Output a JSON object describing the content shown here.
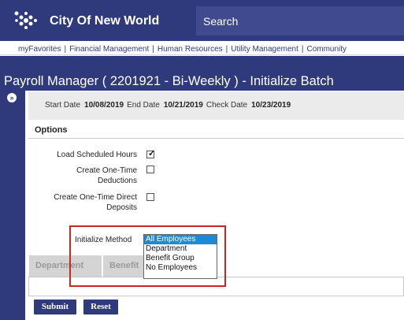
{
  "header": {
    "app_title": "City Of New World",
    "search_label": "Search"
  },
  "nav": {
    "items": [
      "myFavorites",
      "Financial Management",
      "Human Resources",
      "Utility Management",
      "Community"
    ],
    "separator": "|"
  },
  "page": {
    "title": "Payroll Manager ( 2201921 - Bi-Weekly ) - Initialize Batch",
    "expand_glyph": "»"
  },
  "dates": {
    "start_label": "Start Date",
    "start_value": "10/08/2019",
    "end_label": "End Date",
    "end_value": "10/21/2019",
    "check_label": "Check Date",
    "check_value": "10/23/2019"
  },
  "options": {
    "heading": "Options",
    "load_scheduled_hours": {
      "label": "Load Scheduled Hours",
      "checked": true
    },
    "one_time_deductions": {
      "label_line1": "Create One-Time",
      "label_line2": "Deductions",
      "checked": false
    },
    "one_time_deposits": {
      "label_line1": "Create One-Time Direct",
      "label_line2": "Deposits",
      "checked": false
    },
    "check_glyph": "✓"
  },
  "initialize": {
    "label": "Initialize Method",
    "options": [
      "All Employees",
      "Department",
      "Benefit Group",
      "No Employees"
    ],
    "selected": "All Employees"
  },
  "tabs": {
    "department": "Department",
    "benefit": "Benefit Group"
  },
  "buttons": {
    "submit": "Submit",
    "reset": "Reset"
  },
  "colors": {
    "brand": "#2f3a7c",
    "highlight_box": "#c9281e",
    "selected_option": "#1e8ad6"
  }
}
